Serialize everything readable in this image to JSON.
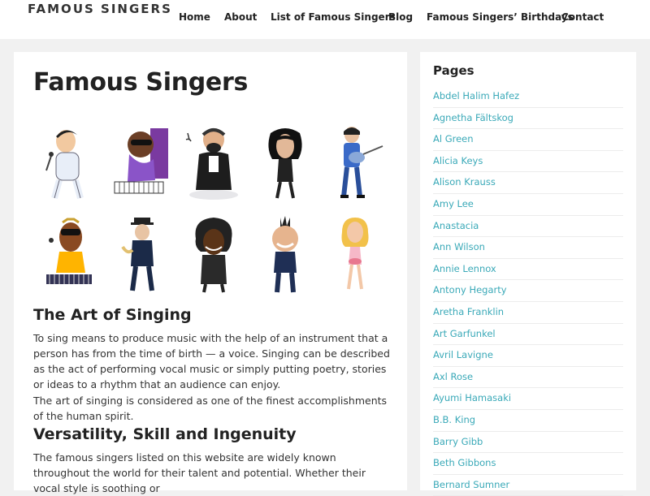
{
  "site": {
    "logo": "FAMOUS SINGERS"
  },
  "nav": [
    "Home",
    "About",
    "List of Famous Singers",
    "Blog",
    "Famous Singers’ Birthdays",
    "Contact"
  ],
  "main": {
    "title": "Famous Singers",
    "gallery": [
      "caricature-elvis-icon",
      "caricature-piano-singer-icon",
      "caricature-tenor-icon",
      "caricature-michael-icon",
      "caricature-guitarist-icon",
      "caricature-keyboard-singer-icon",
      "caricature-hat-singer-icon",
      "caricature-soul-singer-icon",
      "caricature-mohawk-singer-icon",
      "caricature-blonde-singer-icon"
    ],
    "section1_title": "The Art of Singing",
    "para1": "To sing means to produce music with the help of an instrument that a person has from the time of birth — a voice. Singing can be described as the act of performing vocal music or simply putting poetry, stories or ideas to a rhythm that an audience can enjoy.",
    "para2": "The art of singing is considered as one of the finest accomplishments of the human spirit.",
    "section2_title": "Versatility, Skill and Ingenuity",
    "para3": "The famous singers listed on this website are widely known throughout the world for their talent and potential. Whether their vocal style is soothing or"
  },
  "sidebar": {
    "title": "Pages",
    "items": [
      "Abdel Halim Hafez",
      "Agnetha Fältskog",
      "Al Green",
      "Alicia Keys",
      "Alison Krauss",
      "Amy Lee",
      "Anastacia",
      "Ann Wilson",
      "Annie Lennox",
      "Antony Hegarty",
      "Aretha Franklin",
      "Art Garfunkel",
      "Avril Lavigne",
      "Axl Rose",
      "Ayumi Hamasaki",
      "B.B. King",
      "Barry Gibb",
      "Beth Gibbons",
      "Bernard Sumner"
    ]
  },
  "colors": {
    "link": "#3aa9b8",
    "panel": "#ffffff",
    "background": "#f1f1f1"
  }
}
